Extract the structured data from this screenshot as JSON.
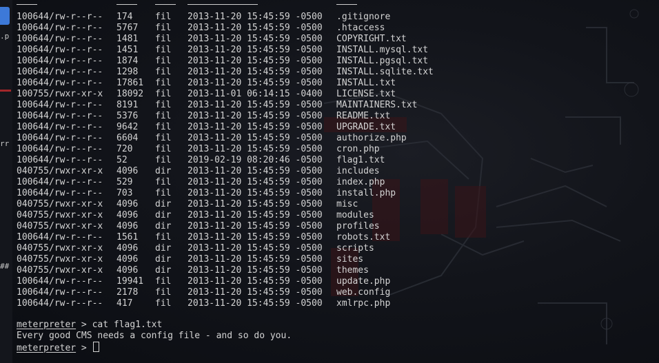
{
  "sidebar": {
    "fragments": [
      ".p",
      "rr",
      "##"
    ]
  },
  "listing": {
    "rows": [
      {
        "mode": "100644/rw-r--r--",
        "size": "174",
        "type": "fil",
        "modified": "2013-11-20 15:45:59 -0500",
        "name": ".gitignore"
      },
      {
        "mode": "100644/rw-r--r--",
        "size": "5767",
        "type": "fil",
        "modified": "2013-11-20 15:45:59 -0500",
        "name": ".htaccess"
      },
      {
        "mode": "100644/rw-r--r--",
        "size": "1481",
        "type": "fil",
        "modified": "2013-11-20 15:45:59 -0500",
        "name": "COPYRIGHT.txt"
      },
      {
        "mode": "100644/rw-r--r--",
        "size": "1451",
        "type": "fil",
        "modified": "2013-11-20 15:45:59 -0500",
        "name": "INSTALL.mysql.txt"
      },
      {
        "mode": "100644/rw-r--r--",
        "size": "1874",
        "type": "fil",
        "modified": "2013-11-20 15:45:59 -0500",
        "name": "INSTALL.pgsql.txt"
      },
      {
        "mode": "100644/rw-r--r--",
        "size": "1298",
        "type": "fil",
        "modified": "2013-11-20 15:45:59 -0500",
        "name": "INSTALL.sqlite.txt"
      },
      {
        "mode": "100644/rw-r--r--",
        "size": "17861",
        "type": "fil",
        "modified": "2013-11-20 15:45:59 -0500",
        "name": "INSTALL.txt"
      },
      {
        "mode": "100755/rwxr-xr-x",
        "size": "18092",
        "type": "fil",
        "modified": "2013-11-01 06:14:15 -0400",
        "name": "LICENSE.txt"
      },
      {
        "mode": "100644/rw-r--r--",
        "size": "8191",
        "type": "fil",
        "modified": "2013-11-20 15:45:59 -0500",
        "name": "MAINTAINERS.txt"
      },
      {
        "mode": "100644/rw-r--r--",
        "size": "5376",
        "type": "fil",
        "modified": "2013-11-20 15:45:59 -0500",
        "name": "README.txt"
      },
      {
        "mode": "100644/rw-r--r--",
        "size": "9642",
        "type": "fil",
        "modified": "2013-11-20 15:45:59 -0500",
        "name": "UPGRADE.txt"
      },
      {
        "mode": "100644/rw-r--r--",
        "size": "6604",
        "type": "fil",
        "modified": "2013-11-20 15:45:59 -0500",
        "name": "authorize.php"
      },
      {
        "mode": "100644/rw-r--r--",
        "size": "720",
        "type": "fil",
        "modified": "2013-11-20 15:45:59 -0500",
        "name": "cron.php"
      },
      {
        "mode": "100644/rw-r--r--",
        "size": "52",
        "type": "fil",
        "modified": "2019-02-19 08:20:46 -0500",
        "name": "flag1.txt"
      },
      {
        "mode": "040755/rwxr-xr-x",
        "size": "4096",
        "type": "dir",
        "modified": "2013-11-20 15:45:59 -0500",
        "name": "includes"
      },
      {
        "mode": "100644/rw-r--r--",
        "size": "529",
        "type": "fil",
        "modified": "2013-11-20 15:45:59 -0500",
        "name": "index.php"
      },
      {
        "mode": "100644/rw-r--r--",
        "size": "703",
        "type": "fil",
        "modified": "2013-11-20 15:45:59 -0500",
        "name": "install.php"
      },
      {
        "mode": "040755/rwxr-xr-x",
        "size": "4096",
        "type": "dir",
        "modified": "2013-11-20 15:45:59 -0500",
        "name": "misc"
      },
      {
        "mode": "040755/rwxr-xr-x",
        "size": "4096",
        "type": "dir",
        "modified": "2013-11-20 15:45:59 -0500",
        "name": "modules"
      },
      {
        "mode": "040755/rwxr-xr-x",
        "size": "4096",
        "type": "dir",
        "modified": "2013-11-20 15:45:59 -0500",
        "name": "profiles"
      },
      {
        "mode": "100644/rw-r--r--",
        "size": "1561",
        "type": "fil",
        "modified": "2013-11-20 15:45:59 -0500",
        "name": "robots.txt"
      },
      {
        "mode": "040755/rwxr-xr-x",
        "size": "4096",
        "type": "dir",
        "modified": "2013-11-20 15:45:59 -0500",
        "name": "scripts"
      },
      {
        "mode": "040755/rwxr-xr-x",
        "size": "4096",
        "type": "dir",
        "modified": "2013-11-20 15:45:59 -0500",
        "name": "sites"
      },
      {
        "mode": "040755/rwxr-xr-x",
        "size": "4096",
        "type": "dir",
        "modified": "2013-11-20 15:45:59 -0500",
        "name": "themes"
      },
      {
        "mode": "100644/rw-r--r--",
        "size": "19941",
        "type": "fil",
        "modified": "2013-11-20 15:45:59 -0500",
        "name": "update.php"
      },
      {
        "mode": "100644/rw-r--r--",
        "size": "2178",
        "type": "fil",
        "modified": "2013-11-20 15:45:59 -0500",
        "name": "web.config"
      },
      {
        "mode": "100644/rw-r--r--",
        "size": "417",
        "type": "fil",
        "modified": "2013-11-20 15:45:59 -0500",
        "name": "xmlrpc.php"
      }
    ]
  },
  "session": {
    "prompt": "meterpreter",
    "prompt_symbol": " > ",
    "command": "cat flag1.txt",
    "output": "Every good CMS needs a config file - and so do you.",
    "current_input": ""
  },
  "colors": {
    "text": "#d4d4d4",
    "background": "#12141a",
    "accent_red": "#a3262a",
    "accent_blue": "#3d79d8"
  }
}
